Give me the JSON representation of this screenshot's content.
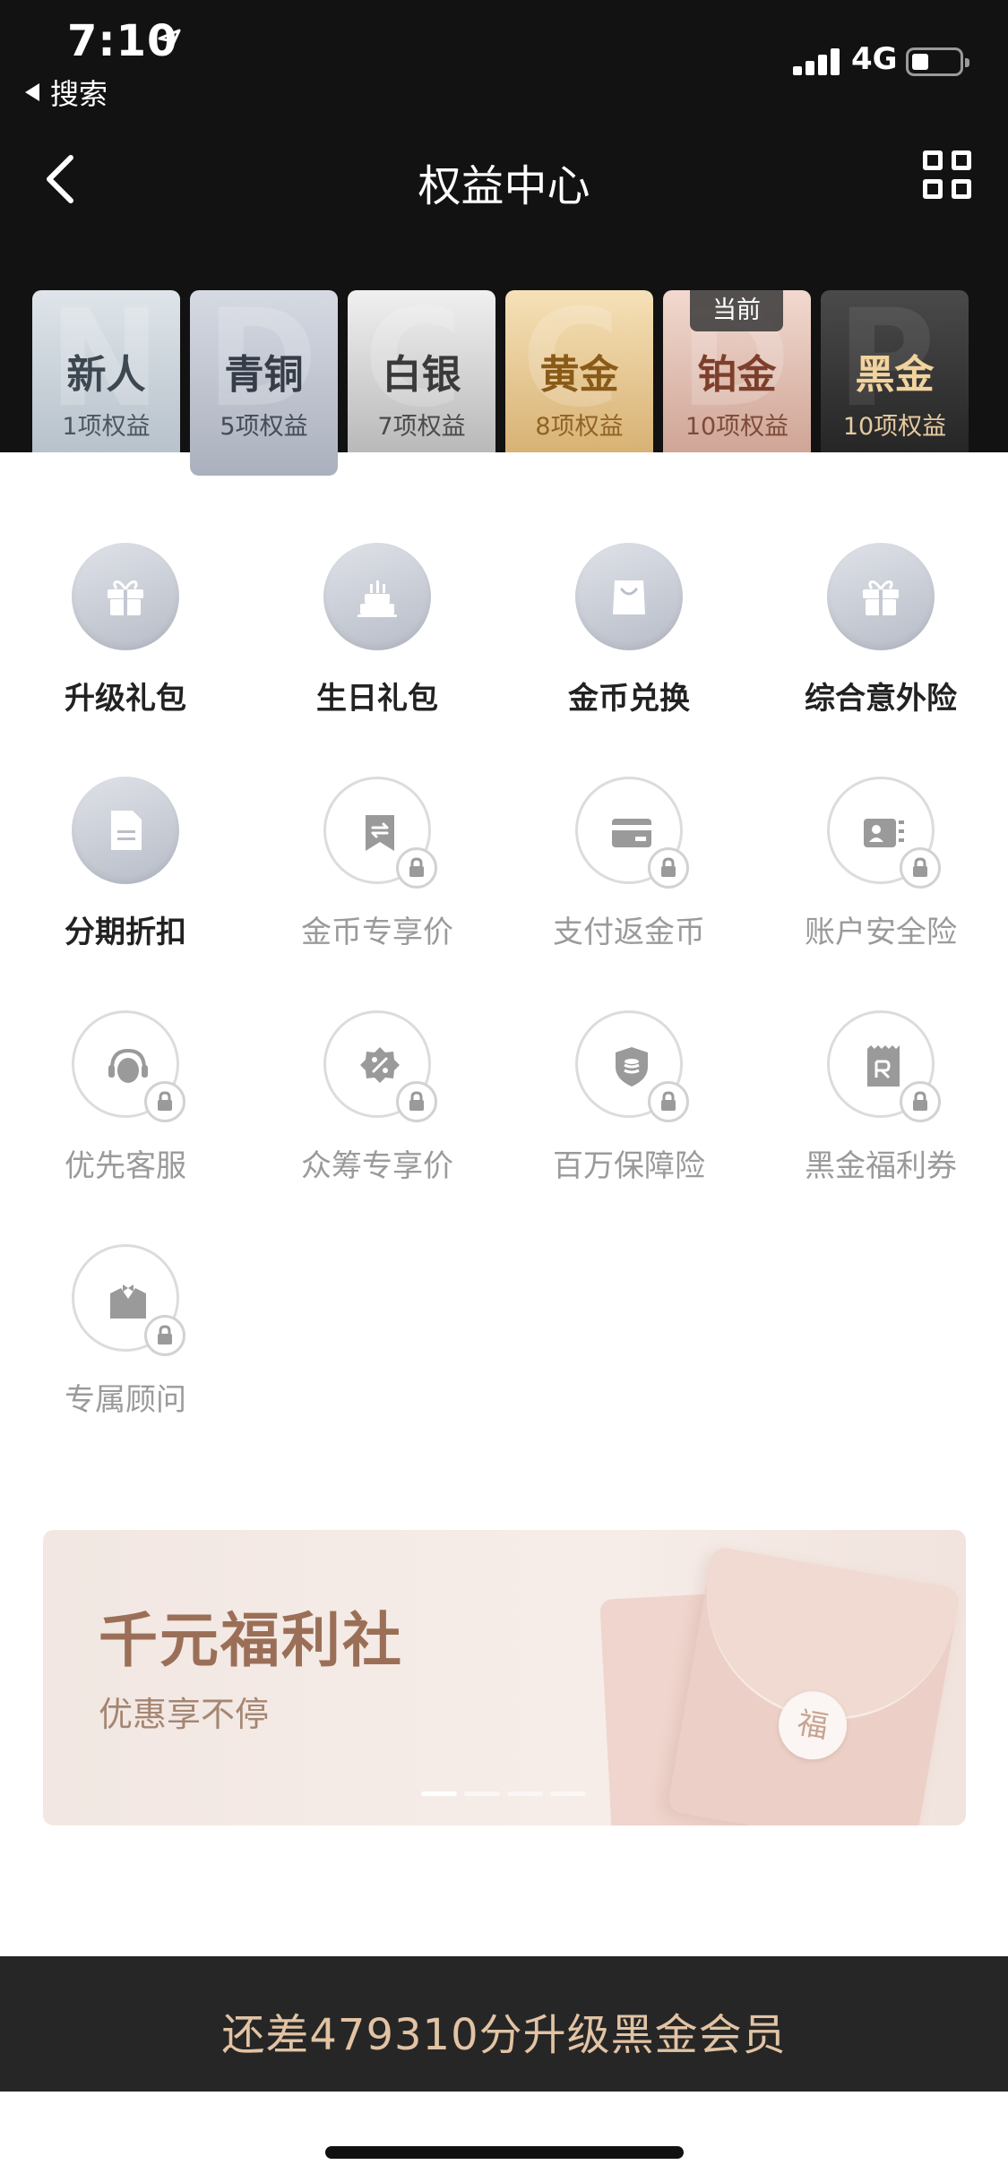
{
  "status_bar": {
    "time": "7:10",
    "back_app_label": "搜索",
    "network": "4G",
    "icons": [
      "location-arrow-icon",
      "signal-icon",
      "battery-icon"
    ]
  },
  "nav": {
    "title": "权益中心",
    "back_icon": "chevron-left-icon",
    "menu_icon": "grid-icon"
  },
  "levels": [
    {
      "name": "新人",
      "count": "1项权益",
      "letter": "N"
    },
    {
      "name": "青铜",
      "count": "5项权益",
      "letter": "D",
      "selected": true
    },
    {
      "name": "白银",
      "count": "7项权益",
      "letter": "C"
    },
    {
      "name": "黄金",
      "count": "8项权益",
      "letter": "C"
    },
    {
      "name": "铂金",
      "count": "10项权益",
      "letter": "D",
      "badge": "当前"
    },
    {
      "name": "黑金",
      "count": "10项权益",
      "letter": "P"
    }
  ],
  "benefits": [
    {
      "label": "升级礼包",
      "icon": "gift-icon",
      "locked": false
    },
    {
      "label": "生日礼包",
      "icon": "birthday-cake-icon",
      "locked": false
    },
    {
      "label": "金币兑换",
      "icon": "shopping-bag-icon",
      "locked": false
    },
    {
      "label": "综合意外险",
      "icon": "gift-icon",
      "locked": false
    },
    {
      "label": "分期折扣",
      "icon": "document-icon",
      "locked": false
    },
    {
      "label": "金币专享价",
      "icon": "price-tag-icon",
      "locked": true
    },
    {
      "label": "支付返金币",
      "icon": "card-icon",
      "locked": true
    },
    {
      "label": "账户安全险",
      "icon": "id-card-icon",
      "locked": true
    },
    {
      "label": "优先客服",
      "icon": "headset-icon",
      "locked": true
    },
    {
      "label": "众筹专享价",
      "icon": "discount-badge-icon",
      "locked": true
    },
    {
      "label": "百万保障险",
      "icon": "shield-icon",
      "locked": true
    },
    {
      "label": "黑金福利券",
      "icon": "coupon-icon",
      "locked": true
    },
    {
      "label": "专属顾问",
      "icon": "butler-icon",
      "locked": true
    }
  ],
  "banner": {
    "title": "千元福利社",
    "subtitle": "优惠享不停",
    "seal_char": "福",
    "slides_total": 4,
    "slide_active": 1
  },
  "upgrade_bar": {
    "text": "还差479310分升级黑金会员"
  },
  "colors": {
    "header_bg": "#121212",
    "accent_gold": "#e2c3a3",
    "banner_title": "#9b6f57"
  }
}
